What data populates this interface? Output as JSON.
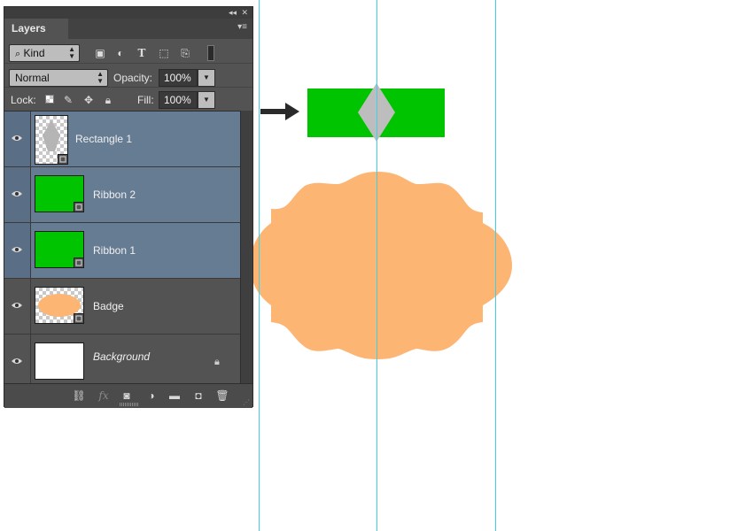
{
  "panel": {
    "tab_label": "Layers",
    "filter": {
      "kind_label": "Kind",
      "icons": [
        "image-filter-icon",
        "adjustment-filter-icon",
        "type-filter-icon",
        "shape-filter-icon",
        "smart-object-filter-icon",
        "filter-toggle-icon"
      ]
    },
    "blend": {
      "mode": "Normal",
      "opacity_label": "Opacity:",
      "opacity_value": "100%"
    },
    "lock": {
      "label": "Lock:",
      "fill_label": "Fill:",
      "fill_value": "100%"
    },
    "layers": [
      {
        "name": "Rectangle 1",
        "selected": true,
        "italic": false,
        "thumb": "gray-diamond"
      },
      {
        "name": "Ribbon 2",
        "selected": true,
        "italic": false,
        "thumb": "green"
      },
      {
        "name": "Ribbon 1",
        "selected": true,
        "italic": false,
        "thumb": "green"
      },
      {
        "name": "Badge",
        "selected": false,
        "italic": false,
        "thumb": "orange-badge"
      },
      {
        "name": "Background",
        "selected": false,
        "italic": true,
        "thumb": "white",
        "locked": true
      }
    ],
    "footer_icons": [
      "link-icon",
      "fx-icon",
      "mask-icon",
      "adjustment-icon",
      "group-folder-icon",
      "new-layer-icon",
      "trash-icon"
    ],
    "fx_label": "fx"
  },
  "canvas": {
    "colors": {
      "ribbon_green": "#00c400",
      "diamond_gray": "#bdbdbd",
      "badge_orange": "#fdb574",
      "guide_cyan": "#3fd0e8",
      "selected_row": "#667c93"
    }
  }
}
